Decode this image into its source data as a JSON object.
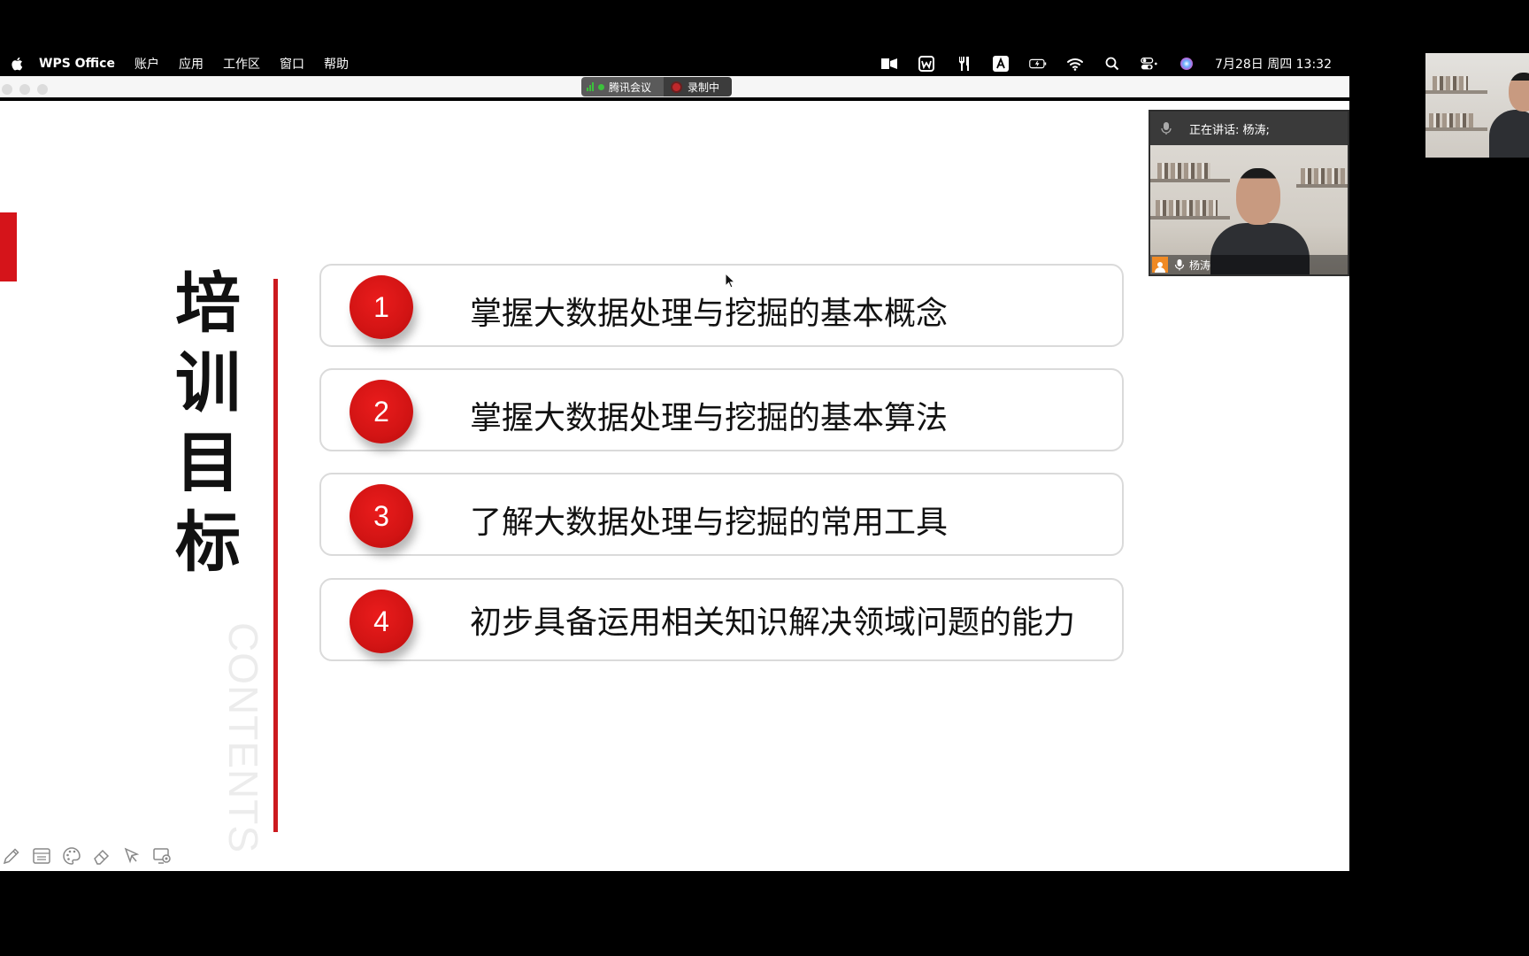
{
  "menubar": {
    "app_name": "WPS Office",
    "menus": [
      "账户",
      "应用",
      "工作区",
      "窗口",
      "帮助"
    ],
    "clock": "7月28日 周四  13:32",
    "status_icons": [
      "screen-share-icon",
      "wps-icon",
      "tools-icon",
      "input-source-icon",
      "battery-icon",
      "wifi-icon",
      "search-icon",
      "control-center-icon",
      "siri-icon"
    ]
  },
  "meeting_bar": {
    "app_label": "腾讯会议",
    "recording_label": "录制中",
    "signal_color": "#3cc13c",
    "record_color": "#c0282b"
  },
  "slide": {
    "title_chars": [
      "培",
      "训",
      "目",
      "标"
    ],
    "watermark": "CONTENTS",
    "accent_color": "#d5141a",
    "items": [
      {
        "number": "1",
        "text": "掌握大数据处理与挖掘的基本概念"
      },
      {
        "number": "2",
        "text": "掌握大数据处理与挖掘的基本算法"
      },
      {
        "number": "3",
        "text": "了解大数据处理与挖掘的常用工具"
      },
      {
        "number": "4",
        "text": "初步具备运用相关知识解决领域问题的能力"
      }
    ]
  },
  "toolbar": {
    "tools": [
      "pen-icon",
      "whiteboard-icon",
      "palette-icon",
      "eraser-icon",
      "pointer-icon",
      "screen-record-icon"
    ]
  },
  "speaker_panel": {
    "speaking_label": "正在讲话: 杨涛;",
    "participant_name": "杨涛"
  }
}
